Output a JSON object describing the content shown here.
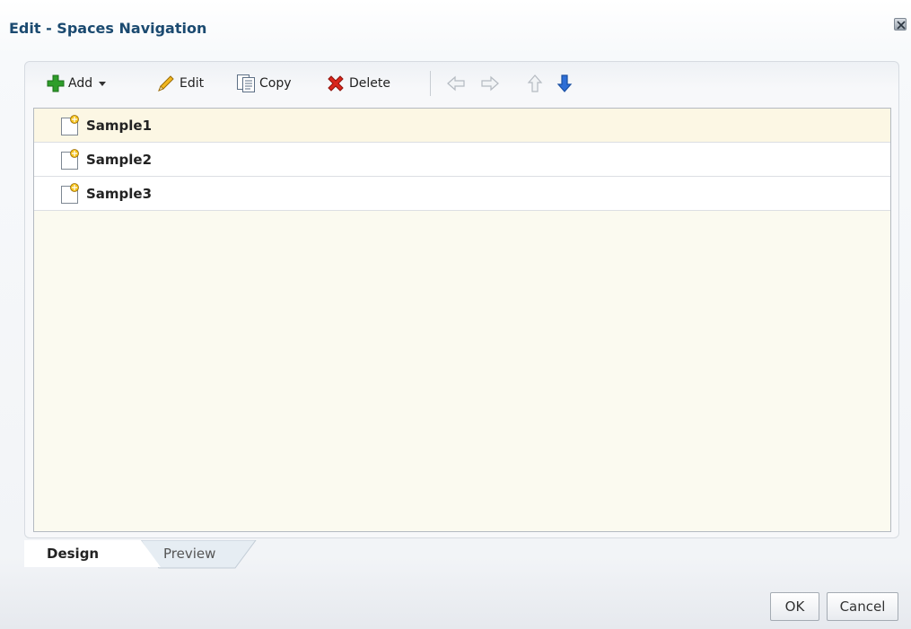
{
  "dialog": {
    "title": "Edit - Spaces Navigation"
  },
  "toolbar": {
    "add_label": "Add",
    "edit_label": "Edit",
    "copy_label": "Copy",
    "delete_label": "Delete",
    "icons": [
      "plus-icon",
      "chevron-down-icon",
      "pencil-icon",
      "copy-icon",
      "delete-icon",
      "arrow-left-icon",
      "arrow-right-icon",
      "arrow-up-icon",
      "arrow-down-icon"
    ]
  },
  "tree": {
    "items": [
      {
        "label": "Sample1",
        "selected": true
      },
      {
        "label": "Sample2",
        "selected": false
      },
      {
        "label": "Sample3",
        "selected": false
      }
    ]
  },
  "tabs": [
    {
      "label": "Design",
      "active": true
    },
    {
      "label": "Preview",
      "active": false
    }
  ],
  "buttons": {
    "ok_label": "OK",
    "cancel_label": "Cancel"
  },
  "colors": {
    "title": "#1b4a70",
    "selected_row": "#fcf7e4",
    "tree_bg": "#fbfaf0",
    "add_green": "#2e9d2a",
    "delete_red": "#d9261c",
    "arrow_blue": "#2f6fd6"
  }
}
